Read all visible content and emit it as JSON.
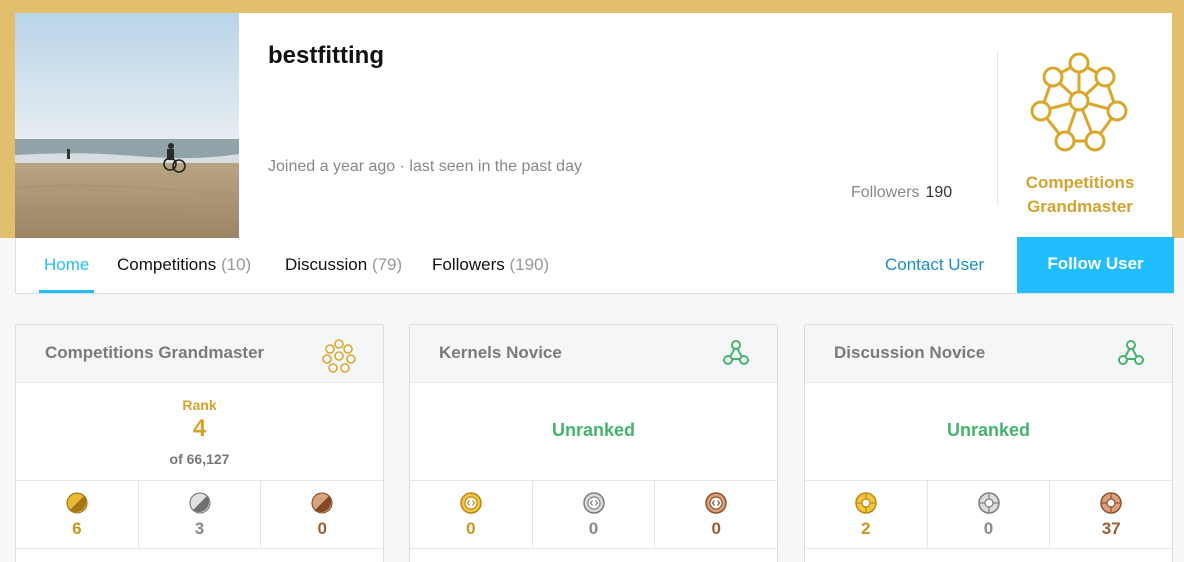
{
  "profile": {
    "username": "bestfitting",
    "joined": "Joined a year ago · last seen in the past day",
    "followers_label": "Followers",
    "followers_count": "190",
    "tier_line1": "Competitions",
    "tier_line2": "Grandmaster",
    "tier_icon": "competitions-grandmaster-icon"
  },
  "nav": {
    "tabs": [
      {
        "label": "Home",
        "count": ""
      },
      {
        "label": "Competitions",
        "count": "(10)"
      },
      {
        "label": "Discussion",
        "count": "(79)"
      },
      {
        "label": "Followers",
        "count": "(190)"
      }
    ],
    "contact": "Contact User",
    "follow": "Follow User",
    "accent": "#20beff"
  },
  "cards": [
    {
      "title": "Competitions Grandmaster",
      "rank_label": "Rank",
      "rank": "4",
      "of": "of 66,127",
      "medals": [
        "6",
        "3",
        "0"
      ]
    },
    {
      "title": "Kernels Novice",
      "status": "Unranked",
      "medals": [
        "0",
        "0",
        "0"
      ]
    },
    {
      "title": "Discussion Novice",
      "status": "Unranked",
      "medals": [
        "2",
        "0",
        "37"
      ]
    }
  ],
  "colors": {
    "gold": "#d4a32c",
    "novice_green": "#45b36f",
    "silver": "#8a8a8a",
    "bronze": "#9a5e34",
    "band": "#e2bf6c"
  }
}
